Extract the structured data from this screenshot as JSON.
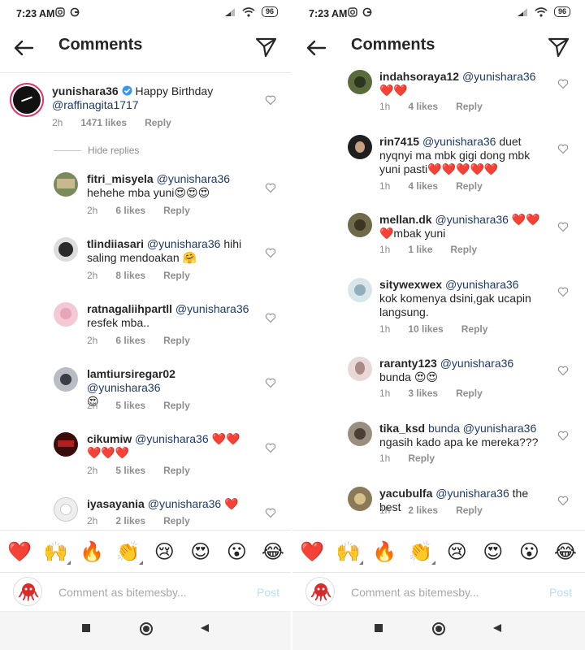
{
  "status": {
    "time": "7:23 AM",
    "battery": "96"
  },
  "header": {
    "title": "Comments"
  },
  "hide_replies": "Hide replies",
  "composer": {
    "placeholder": "Comment as bitemesby...",
    "post": "Post"
  },
  "emojis": [
    "❤️",
    "🙌",
    "🔥",
    "👏",
    "😢",
    "😍",
    "😮",
    "😂"
  ],
  "left": {
    "main": {
      "user": "yunishara36",
      "text": "Happy Birthday",
      "mention": "@raffinagita1717",
      "time": "2h",
      "likes": "1471 likes",
      "reply": "Reply"
    },
    "replies": [
      {
        "user": "fitri_misyela",
        "mention": "@yunishara36",
        "text": "hehehe mba yuni😍😍😍",
        "time": "2h",
        "likes": "6 likes",
        "reply": "Reply"
      },
      {
        "user": "tlindiiasari",
        "mention": "@yunishara36",
        "text": "hihi saling mendoakan 🤗",
        "time": "2h",
        "likes": "8 likes",
        "reply": "Reply"
      },
      {
        "user": "ratnagaliihpartll",
        "mention": "@yunishara36",
        "text": "resfek mba..",
        "time": "2h",
        "likes": "6 likes",
        "reply": "Reply"
      },
      {
        "user": "lamtiursiregar02",
        "mention": "@yunishara36",
        "text": "😍",
        "time": "2h",
        "likes": "5 likes",
        "reply": "Reply"
      },
      {
        "user": "cikumiw",
        "mention": "@yunishara36",
        "text": "❤️❤️❤️❤️❤️",
        "time": "2h",
        "likes": "5 likes",
        "reply": "Reply"
      },
      {
        "user": "iyasayania",
        "mention": "@yunishara36",
        "text": "❤️",
        "time": "2h",
        "likes": "2 likes",
        "reply": "Reply"
      }
    ]
  },
  "right": {
    "replies": [
      {
        "user": "indahsoraya12",
        "mention": "@yunishara36",
        "text": "❤️❤️",
        "time": "1h",
        "likes": "4 likes",
        "reply": "Reply"
      },
      {
        "user": "rin7415",
        "mention": "@yunishara36",
        "text": "duet nyqnyi ma mbk gigi dong mbk yuni pasti❤️❤️❤️❤️❤️",
        "time": "1h",
        "likes": "4 likes",
        "reply": "Reply"
      },
      {
        "user": "mellan.dk",
        "mention": "@yunishara36",
        "text": "❤️❤️❤️mbak yuni",
        "time": "1h",
        "likes": "1 like",
        "reply": "Reply"
      },
      {
        "user": "sitywexwex",
        "mention": "@yunishara36",
        "text": "kok komenya dsini,gak ucapin langsung.",
        "time": "1h",
        "likes": "10 likes",
        "reply": "Reply"
      },
      {
        "user": "raranty123",
        "mention": "@yunishara36",
        "text": "bunda 😍😍",
        "time": "1h",
        "likes": "3 likes",
        "reply": "Reply"
      },
      {
        "user": "tika_ksd",
        "mention": "bunda @yunishara36",
        "text": "ngasih kado apa ke mereka???",
        "time": "1h",
        "likes": "",
        "reply": "Reply"
      },
      {
        "user": "yacubulfa",
        "mention": "@yunishara36",
        "text": "the best",
        "time": "1h",
        "likes": "2 likes",
        "reply": "Reply"
      }
    ]
  },
  "colors": {
    "accent": "#0095f6",
    "mention": "#1f3a66",
    "muted": "#8e8e8e",
    "heart_red": "#ed4956"
  }
}
